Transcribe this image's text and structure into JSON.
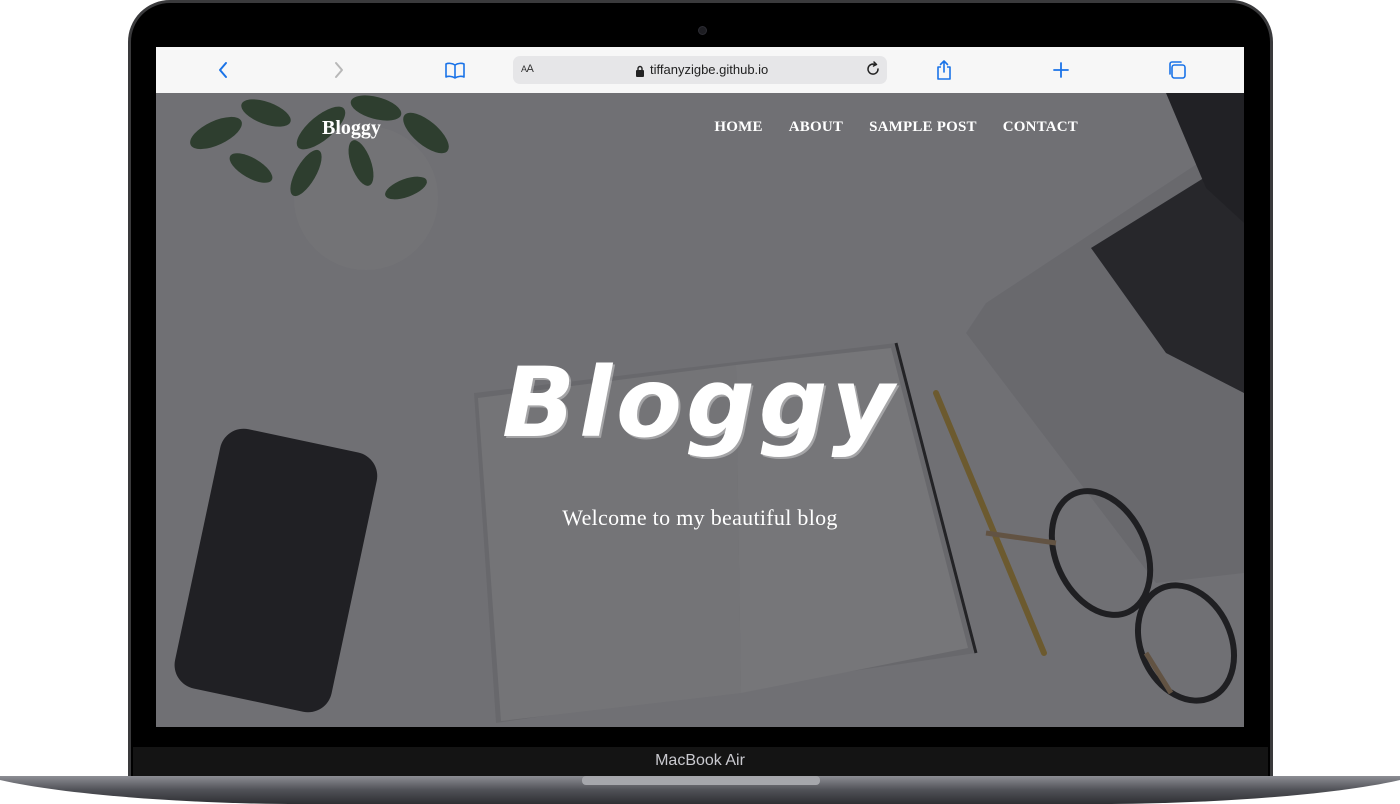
{
  "device": {
    "model_label": "MacBook Air"
  },
  "browser": {
    "url": "tiffanyzigbe.github.io",
    "text_size_label": "AA",
    "icons": [
      "back-icon",
      "forward-icon",
      "bookmarks-icon",
      "lock-icon",
      "reload-icon",
      "share-icon",
      "new-tab-icon",
      "tabs-icon"
    ]
  },
  "site": {
    "brand": "Bloggy",
    "nav": [
      {
        "label": "HOME"
      },
      {
        "label": "ABOUT"
      },
      {
        "label": "SAMPLE POST"
      },
      {
        "label": "CONTACT"
      }
    ],
    "hero": {
      "title": "Bloggy",
      "subtitle": "Welcome to my beautiful blog"
    }
  },
  "colors": {
    "accent": "#1a73e8",
    "overlay": "#2d2d32",
    "text_on_dark": "#ffffff"
  }
}
